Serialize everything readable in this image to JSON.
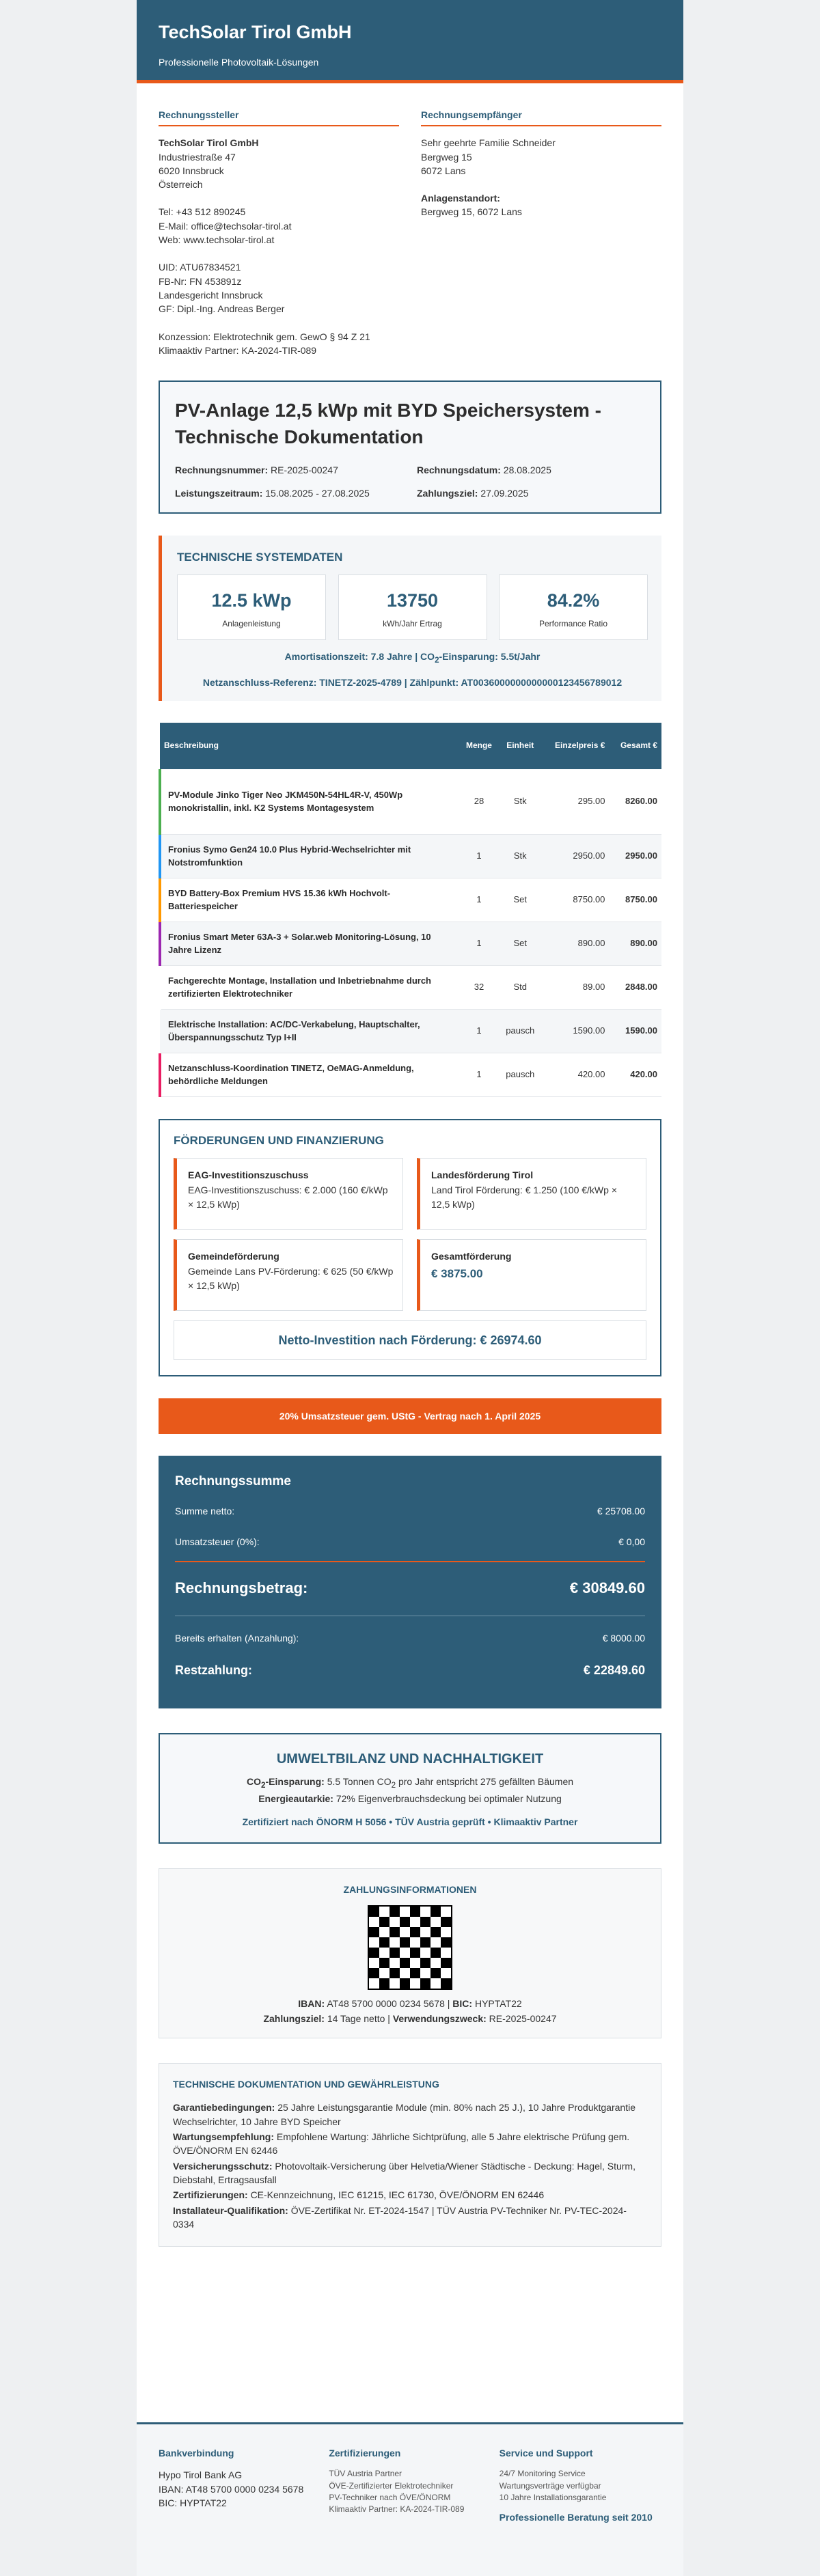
{
  "header": {
    "company": "TechSolar Tirol GmbH",
    "tagline": "Professionelle Photovoltaik-Lösungen"
  },
  "sender": {
    "title": "Rechnungssteller",
    "name": "TechSolar Tirol GmbH",
    "street": "Industriestraße 47",
    "city": "6020 Innsbruck",
    "country": "Österreich",
    "tel": "Tel: +43 512 890245",
    "email": "E-Mail: office@techsolar-tirol.at",
    "web": "Web: www.techsolar-tirol.at",
    "uid": "UID: ATU67834521",
    "fb": "FB-Nr: FN 453891z",
    "court": "Landesgericht Innsbruck",
    "gf": "GF: Dipl.-Ing. Andreas Berger",
    "license": "Konzession: Elektrotechnik gem. GewO § 94 Z 21",
    "klimaaktiv": "Klimaaktiv Partner: KA-2024-TIR-089"
  },
  "recipient": {
    "title": "Rechnungsempfänger",
    "name": "Sehr geehrte Familie Schneider",
    "street": "Bergweg 15",
    "city": "6072 Lans",
    "site_label": "Anlagenstandort:",
    "site_value": "Bergweg 15, 6072 Lans"
  },
  "doc": {
    "title": "PV-Anlage 12,5 kWp mit BYD Speichersystem - Technische Dokumentation",
    "invoice_no_label": "Rechnungsnummer:",
    "invoice_no": "RE-2025-00247",
    "invoice_date_label": "Rechnungsdatum:",
    "invoice_date": "28.08.2025",
    "period_label": "Leistungszeitraum:",
    "period": "15.08.2025 - 27.08.2025",
    "due_label": "Zahlungsziel:",
    "due": "27.09.2025"
  },
  "system": {
    "title": "TECHNISCHE SYSTEMDATEN",
    "metrics": [
      {
        "value": "12.5 kWp",
        "label": "Anlagenleistung"
      },
      {
        "value": "13750",
        "label": "kWh/Jahr Ertrag"
      },
      {
        "value": "84.2%",
        "label": "Performance Ratio"
      }
    ],
    "line1_a": "Amortisationszeit: 7.8 Jahre | CO",
    "line1_sub": "2",
    "line1_b": "-Einsparung: 5.5t/Jahr",
    "line2": "Netzanschluss-Referenz: TINETZ-2025-4789 | Zählpunkt: AT0036000000000000123456789012"
  },
  "table": {
    "headers": {
      "desc": "Beschreibung",
      "qty": "Menge",
      "unit": "Einheit",
      "price": "Einzelpreis €",
      "total": "Gesamt €"
    },
    "rows": [
      {
        "desc": "PV-Module Jinko Tiger Neo JKM450N-54HL4R-V, 450Wp monokristallin, inkl. K2 Systems Montagesystem",
        "qty": "28",
        "unit": "Stk",
        "price": "295.00",
        "total": "8260.00",
        "color": "#4caf50"
      },
      {
        "desc": "Fronius Symo Gen24 10.0 Plus Hybrid-Wechselrichter mit Notstromfunktion",
        "qty": "1",
        "unit": "Stk",
        "price": "2950.00",
        "total": "2950.00",
        "color": "#2196f3"
      },
      {
        "desc": "BYD Battery-Box Premium HVS 15.36 kWh Hochvolt-Batteriespeicher",
        "qty": "1",
        "unit": "Set",
        "price": "8750.00",
        "total": "8750.00",
        "color": "#ff9800"
      },
      {
        "desc": "Fronius Smart Meter 63A-3 + Solar.web Monitoring-Lösung, 10 Jahre Lizenz",
        "qty": "1",
        "unit": "Set",
        "price": "890.00",
        "total": "890.00",
        "color": "#9c27b0"
      },
      {
        "desc": "Fachgerechte Montage, Installation und Inbetriebnahme durch zertifizierten Elektrotechniker",
        "qty": "32",
        "unit": "Std",
        "price": "89.00",
        "total": "2848.00",
        "color": ""
      },
      {
        "desc": "Elektrische Installation: AC/DC-Verkabelung, Hauptschalter, Überspannungsschutz Typ I+II",
        "qty": "1",
        "unit": "pausch",
        "price": "1590.00",
        "total": "1590.00",
        "color": ""
      },
      {
        "desc": "Netzanschluss-Koordination TINETZ, OeMAG-Anmeldung, behördliche Meldungen",
        "qty": "1",
        "unit": "pausch",
        "price": "420.00",
        "total": "420.00",
        "color": "#e91e63"
      }
    ]
  },
  "funding": {
    "title": "FÖRDERUNGEN UND FINANZIERUNG",
    "items": [
      {
        "title": "EAG-Investitionszuschuss",
        "desc": "EAG-Investitionszuschuss: € 2.000 (160 €/kWp × 12,5 kWp)"
      },
      {
        "title": "Landesförderung Tirol",
        "desc": "Land Tirol Förderung: € 1.250 (100 €/kWp × 12,5 kWp)"
      },
      {
        "title": "Gemeindeförderung",
        "desc": "Gemeinde Lans PV-Förderung: € 625 (50 €/kWp × 12,5 kWp)"
      }
    ],
    "total_title": "Gesamtförderung",
    "total_value": "€ 3875.00",
    "net": "Netto-Investition nach Förderung: € 26974.60"
  },
  "vat_banner": "20% Umsatzsteuer gem. UStG - Vertrag nach 1. April 2025",
  "summary": {
    "title": "Rechnungssumme",
    "net_label": "Summe netto:",
    "net_value": "€ 25708.00",
    "vat_label": "Umsatzsteuer (0%):",
    "vat_value": "€ 0,00",
    "total_label": "Rechnungsbetrag:",
    "total_value": "€ 30849.60",
    "received_label": "Bereits erhalten (Anzahlung):",
    "received_value": "€ 8000.00",
    "rest_label": "Restzahlung:",
    "rest_value": "€ 22849.60"
  },
  "environment": {
    "title": "UMWELTBILANZ UND NACHHALTIGKEIT",
    "co2_label_a": "CO",
    "co2_label_sub": "2",
    "co2_label_b": "-Einsparung:",
    "co2_text_a": "5.5 Tonnen CO",
    "co2_text_sub": "2",
    "co2_text_b": " pro Jahr entspricht 275 gefällten Bäumen",
    "energy_label": "Energieautarkie:",
    "energy_text": "72% Eigenverbrauchsdeckung bei optimaler Nutzung",
    "cert": "Zertifiziert nach ÖNORM H 5056 • TÜV Austria geprüft • Klimaaktiv Partner"
  },
  "payment": {
    "title": "ZAHLUNGSINFORMATIONEN",
    "iban_label": "IBAN:",
    "iban": "AT48 5700 0000 0234 5678",
    "bic_label": "BIC:",
    "bic": "HYPTAT22",
    "due_label": "Zahlungsziel:",
    "due": "14 Tage netto",
    "purpose_label": "Verwendungszweck:",
    "purpose": "RE-2025-00247"
  },
  "techdoc": {
    "title": "TECHNISCHE DOKUMENTATION UND GEWÄHRLEISTUNG",
    "items": [
      {
        "label": "Garantiebedingungen:",
        "text": "25 Jahre Leistungsgarantie Module (min. 80% nach 25 J.), 10 Jahre Produktgarantie Wechselrichter, 10 Jahre BYD Speicher"
      },
      {
        "label": "Wartungsempfehlung:",
        "text": "Empfohlene Wartung: Jährliche Sichtprüfung, alle 5 Jahre elektrische Prüfung gem. ÖVE/ÖNORM EN 62446"
      },
      {
        "label": "Versicherungsschutz:",
        "text": "Photovoltaik-Versicherung über Helvetia/Wiener Städtische - Deckung: Hagel, Sturm, Diebstahl, Ertragsausfall"
      },
      {
        "label": "Zertifizierungen:",
        "text": "CE-Kennzeichnung, IEC 61215, IEC 61730, ÖVE/ÖNORM EN 62446"
      },
      {
        "label": "Installateur-Qualifikation:",
        "text": "ÖVE-Zertifikat Nr. ET-2024-1547 | TÜV Austria PV-Techniker Nr. PV-TEC-2024-0334"
      }
    ]
  },
  "footer": {
    "bank_title": "Bankverbindung",
    "bank_name": "Hypo Tirol Bank AG",
    "bank_iban": "IBAN: AT48 5700 0000 0234 5678",
    "bank_bic": "BIC: HYPTAT22",
    "cert_title": "Zertifizierungen",
    "cert_1": "TÜV Austria Partner",
    "cert_2": "ÖVE-Zertifizierter Elektrotechniker",
    "cert_3": "PV-Techniker nach ÖVE/ÖNORM",
    "cert_4": "Klimaaktiv Partner: KA-2024-TIR-089",
    "service_title": "Service und Support",
    "service_1": "24/7 Monitoring Service",
    "service_2": "Wartungsverträge verfügbar",
    "service_3": "10 Jahre Installationsgarantie",
    "service_hl": "Professionelle Beratung seit 2010"
  },
  "colors": {
    "primary": "#2d5d78",
    "accent": "#e8591a"
  }
}
